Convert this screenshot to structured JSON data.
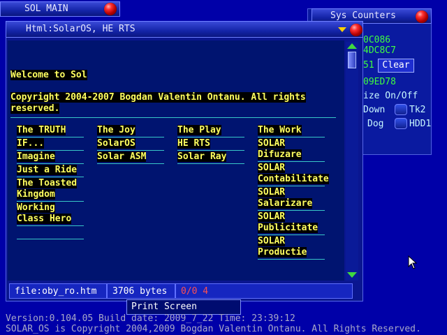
{
  "sol_main": {
    "title": "SOL MAIN"
  },
  "sys_counters": {
    "title": "Sys Counters",
    "value1": "0C086",
    "value2": "4DC8C7",
    "value3": "51",
    "clear_label": "Clear",
    "value4": "09ED78",
    "size_label": "ize On/Off",
    "down_label": "Down",
    "tk2_label": "Tk2",
    "dog_label": "Dog",
    "hdd1_label": "HDD1"
  },
  "html_window": {
    "title": "Html:SolarOS, HE RTS",
    "welcome": "Welcome to Sol",
    "copyright_line1": "Copyright 2004-2007 Bogdan Valentin Ontanu. All rights",
    "copyright_line2": "reserved.",
    "columns": [
      {
        "header": "The TRUTH",
        "items": [
          "IF...",
          "Imagine",
          "Just a Ride",
          "The Toasted Kingdom",
          "Working Class Hero",
          ""
        ]
      },
      {
        "header": "The Joy",
        "items": [
          "SolarOS",
          "Solar ASM"
        ]
      },
      {
        "header": "The Play",
        "items": [
          "HE RTS",
          "Solar Ray"
        ]
      },
      {
        "header": "The Work",
        "items": [
          "SOLAR Difuzare",
          "SOLAR Contabilitate",
          "SOLAR Salarizare",
          "SOLAR Publicitate",
          "SOLAR Productie"
        ]
      }
    ],
    "status": {
      "file": "file:oby_ro.htm",
      "size": "3706 bytes",
      "counter": "0/0 4"
    }
  },
  "print_screen_label": "Print Screen",
  "footer": {
    "version_line": "Version:0.104.05  Build date: 2009_7_22  Time: 23:39:12",
    "copyright_line": "SOLAR_OS is Copyright 2004,2009 Bogdan Valentin Ontanu. All Rights Reserved."
  },
  "colors": {
    "desktop": "#0000a8",
    "link_text": "#ffff60",
    "separator": "#38c8c8",
    "status_red": "#ff5050"
  },
  "icons": {
    "close": "red-ball-icon",
    "dropdown": "yellow-triangle-icon",
    "cursor": "mouse-pointer-icon"
  }
}
